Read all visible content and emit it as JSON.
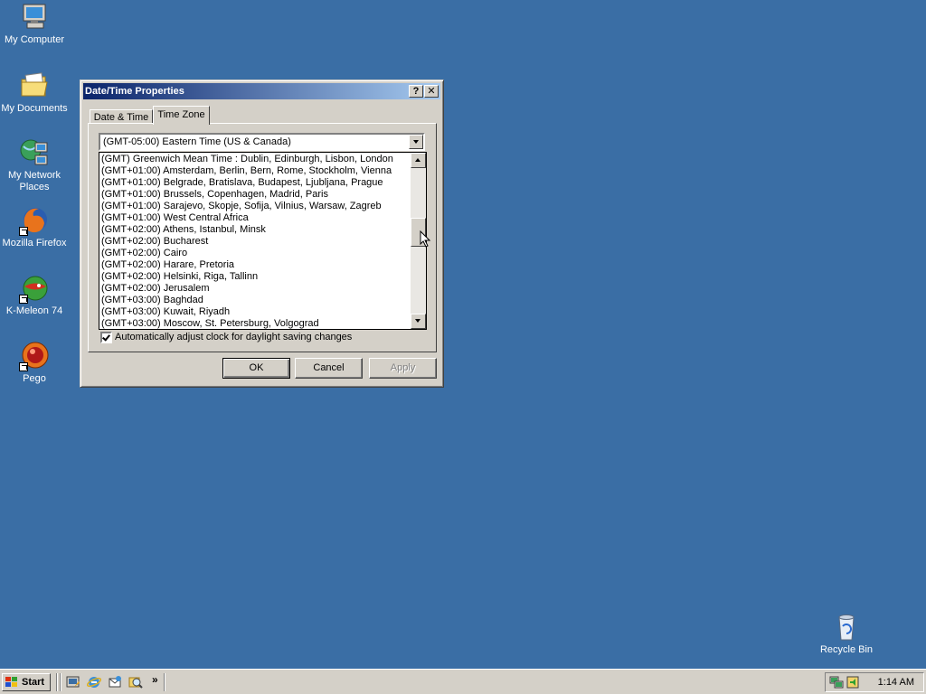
{
  "desktop": {
    "icons": [
      {
        "label": "My Computer",
        "icon": "computer-icon"
      },
      {
        "label": "My Documents",
        "icon": "folder-icon"
      },
      {
        "label": "My Network",
        "label2": "Places",
        "icon": "network-icon"
      },
      {
        "label": "Mozilla Firefox",
        "icon": "firefox-icon"
      },
      {
        "label": "K-Meleon 74",
        "icon": "k-meleon-icon"
      },
      {
        "label": "Pego",
        "icon": "pego-icon"
      },
      {
        "label": "Recycle Bin",
        "icon": "recycle-bin-icon"
      }
    ]
  },
  "dialog": {
    "title": "Date/Time Properties",
    "help_label": "?",
    "close_label": "✕",
    "tabs": [
      {
        "label": "Date & Time",
        "active": false
      },
      {
        "label": "Time Zone",
        "active": true
      }
    ],
    "timezone_selected": "(GMT-05:00) Eastern Time (US & Canada)",
    "timezone_options": [
      "(GMT) Greenwich Mean Time : Dublin, Edinburgh, Lisbon, London",
      "(GMT+01:00) Amsterdam, Berlin, Bern, Rome, Stockholm, Vienna",
      "(GMT+01:00) Belgrade, Bratislava, Budapest, Ljubljana, Prague",
      "(GMT+01:00) Brussels, Copenhagen, Madrid, Paris",
      "(GMT+01:00) Sarajevo, Skopje, Sofija, Vilnius, Warsaw, Zagreb",
      "(GMT+01:00) West Central Africa",
      "(GMT+02:00) Athens, Istanbul, Minsk",
      "(GMT+02:00) Bucharest",
      "(GMT+02:00) Cairo",
      "(GMT+02:00) Harare, Pretoria",
      "(GMT+02:00) Helsinki, Riga, Tallinn",
      "(GMT+02:00) Jerusalem",
      "(GMT+03:00) Baghdad",
      "(GMT+03:00) Kuwait, Riyadh",
      "(GMT+03:00) Moscow, St. Petersburg, Volgograd"
    ],
    "daylight_label": "Automatically adjust clock for daylight saving changes",
    "daylight_checked": true,
    "ok_label": "OK",
    "cancel_label": "Cancel",
    "apply_label": "Apply"
  },
  "taskbar": {
    "start_label": "Start",
    "quicklaunch": [
      "show-desktop-icon",
      "internet-explorer-icon",
      "outlook-express-icon",
      "search-icon"
    ],
    "chevron_label": "»",
    "clock": "1:14 AM"
  },
  "colors": {
    "desktop": "#3a6ea5",
    "title_start": "#0a246a",
    "title_end": "#a6caf0",
    "face": "#d4d0c8"
  }
}
